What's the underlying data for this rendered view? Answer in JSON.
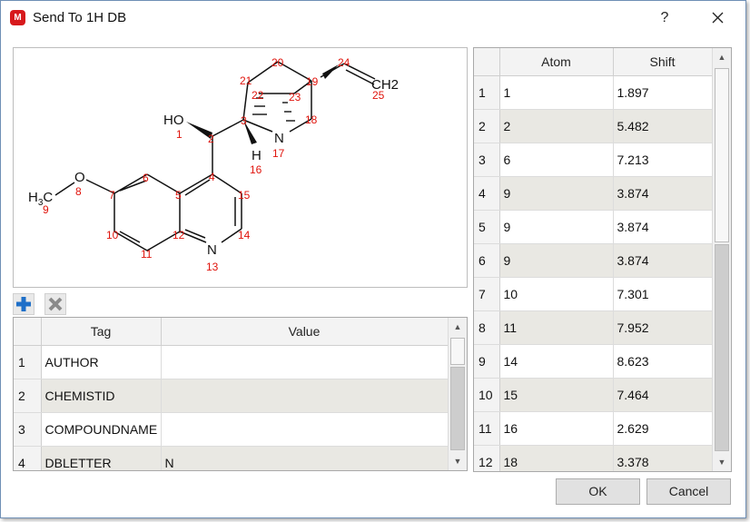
{
  "window": {
    "title": "Send To 1H DB",
    "help_label": "?"
  },
  "structure": {
    "atoms": [
      {
        "label": "HO",
        "num": "1"
      },
      {
        "label": "H",
        "num": "16"
      },
      {
        "label": "N",
        "num": "17"
      },
      {
        "label": "O",
        "num": "8"
      },
      {
        "label": "N",
        "num": "13"
      },
      {
        "label": "CH2",
        "num": "25"
      }
    ],
    "numbers": [
      "2",
      "3",
      "4",
      "5",
      "6",
      "7",
      "9",
      "10",
      "11",
      "12",
      "14",
      "15",
      "18",
      "19",
      "20",
      "21",
      "22",
      "23",
      "24"
    ]
  },
  "tags_table": {
    "columns": [
      "Tag",
      "Value"
    ],
    "rows": [
      {
        "num": "1",
        "tag": "AUTHOR",
        "value": ""
      },
      {
        "num": "2",
        "tag": "CHEMISTID",
        "value": ""
      },
      {
        "num": "3",
        "tag": "COMPOUNDNAME",
        "value": ""
      },
      {
        "num": "4",
        "tag": "DBLETTER",
        "value": "N"
      }
    ]
  },
  "shift_table": {
    "columns": [
      "Atom",
      "Shift"
    ],
    "rows": [
      {
        "num": "1",
        "atom": "1",
        "shift": "1.897"
      },
      {
        "num": "2",
        "atom": "2",
        "shift": "5.482"
      },
      {
        "num": "3",
        "atom": "6",
        "shift": "7.213"
      },
      {
        "num": "4",
        "atom": "9",
        "shift": "3.874"
      },
      {
        "num": "5",
        "atom": "9",
        "shift": "3.874"
      },
      {
        "num": "6",
        "atom": "9",
        "shift": "3.874"
      },
      {
        "num": "7",
        "atom": "10",
        "shift": "7.301"
      },
      {
        "num": "8",
        "atom": "11",
        "shift": "7.952"
      },
      {
        "num": "9",
        "atom": "14",
        "shift": "8.623"
      },
      {
        "num": "10",
        "atom": "15",
        "shift": "7.464"
      },
      {
        "num": "11",
        "atom": "16",
        "shift": "2.629"
      },
      {
        "num": "12",
        "atom": "18",
        "shift": "3.378"
      }
    ]
  },
  "buttons": {
    "ok": "OK",
    "cancel": "Cancel"
  },
  "icons": {
    "add": "plus-icon",
    "remove": "x-icon",
    "close": "close-icon",
    "app": "app-logo-icon"
  },
  "colors": {
    "accent": "#1e6fc8",
    "atom_number": "#e0140c",
    "app_icon": "#d7191c",
    "row_alt": "#e9e8e3"
  }
}
